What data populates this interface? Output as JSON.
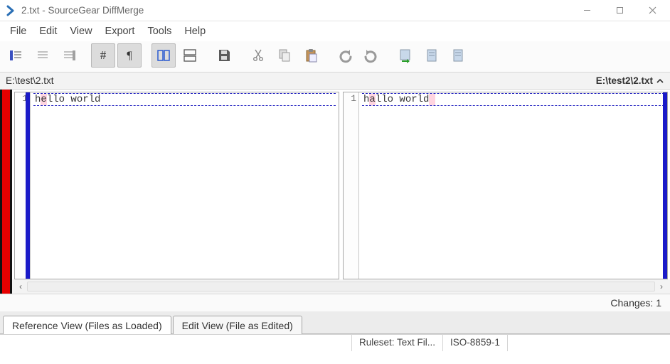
{
  "window": {
    "title": "2.txt - SourceGear DiffMerge"
  },
  "menu": {
    "file": "File",
    "edit": "Edit",
    "view": "View",
    "export": "Export",
    "tools": "Tools",
    "help": "Help"
  },
  "paths": {
    "left": "E:\\test\\2.txt",
    "right": "E:\\test2\\2.txt"
  },
  "diff": {
    "left_line_no": "1",
    "right_line_no": "1",
    "left_pre": "h",
    "left_hl": "e",
    "left_post": "llo world",
    "right_pre": "h",
    "right_hl": "a",
    "right_post": "llo world",
    "right_trail_hl": " "
  },
  "summary": {
    "changes_label": "Changes: 1"
  },
  "tabs": {
    "reference": "Reference View (Files as Loaded)",
    "edit": "Edit View (File as Edited)"
  },
  "status": {
    "ruleset": "Ruleset: Text Fil...",
    "encoding": "ISO-8859-1"
  }
}
